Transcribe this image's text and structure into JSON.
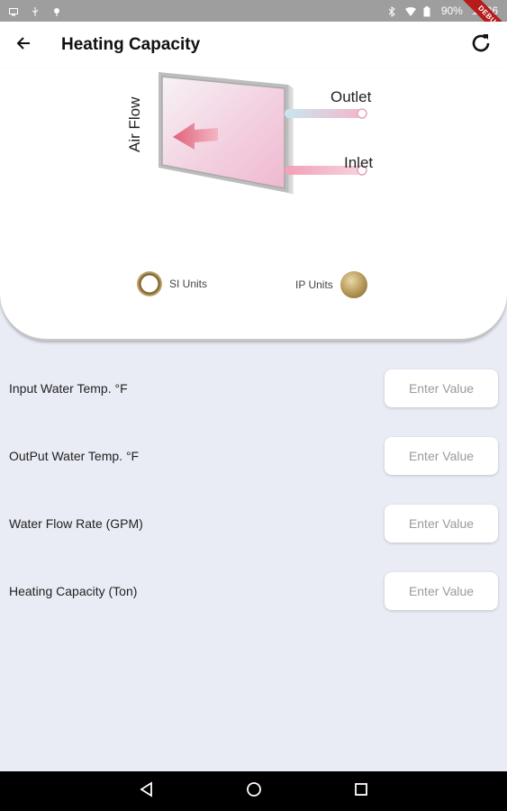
{
  "status_bar": {
    "battery": "90%",
    "time": "11:36",
    "debug_banner": "DEBUG"
  },
  "app_bar": {
    "title": "Heating Capacity"
  },
  "diagram": {
    "outlet_label": "Outlet",
    "inlet_label": "Inlet",
    "airflow_label": "Air Flow"
  },
  "units": {
    "si_label": "SI Units",
    "ip_label": "IP Units",
    "selected": "IP Units"
  },
  "form": {
    "rows": [
      {
        "label": "Input Water Temp. °F",
        "placeholder": "Enter Value",
        "value": ""
      },
      {
        "label": "OutPut Water Temp. °F",
        "placeholder": "Enter Value",
        "value": ""
      },
      {
        "label": "Water Flow Rate (GPM)",
        "placeholder": "Enter Value",
        "value": ""
      },
      {
        "label": "Heating Capacity (Ton)",
        "placeholder": "Enter Value",
        "value": ""
      }
    ]
  },
  "colors": {
    "background": "#e9ecf4",
    "accent_gold": "#b99a5a"
  }
}
